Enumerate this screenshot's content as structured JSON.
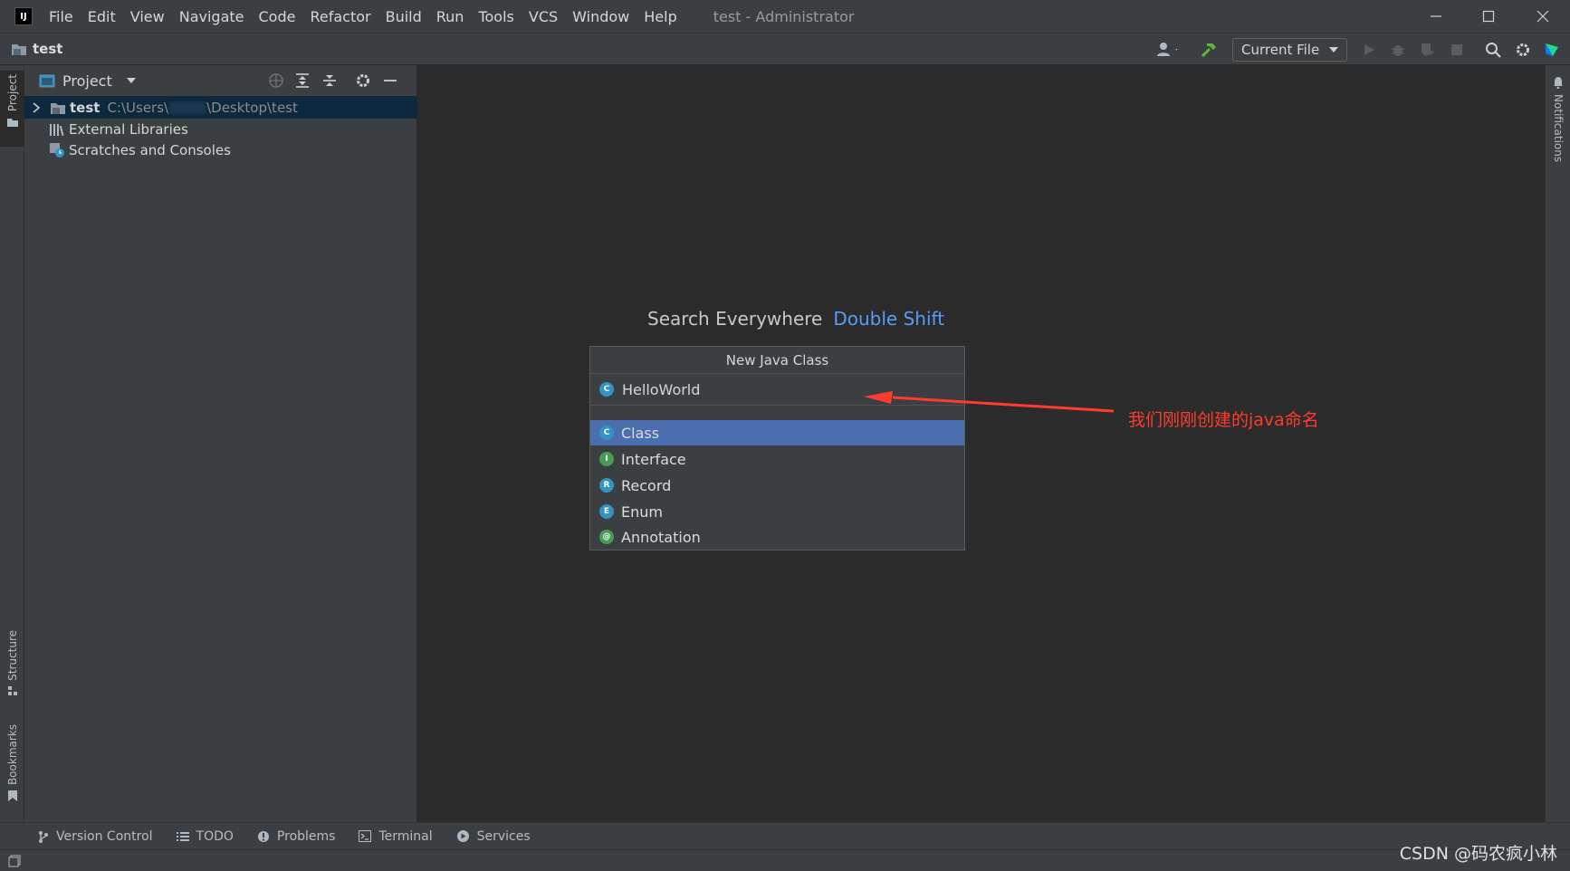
{
  "menubar": {
    "logo_text": "IJ",
    "items": [
      "File",
      "Edit",
      "View",
      "Navigate",
      "Code",
      "Refactor",
      "Build",
      "Run",
      "Tools",
      "VCS",
      "Window",
      "Help"
    ],
    "title": "test - Administrator"
  },
  "navbar": {
    "breadcrumb": "test",
    "run_config": "Current File"
  },
  "left_strip": {
    "project": "Project",
    "structure": "Structure",
    "bookmarks": "Bookmarks"
  },
  "project_panel": {
    "title": "Project",
    "tree": [
      {
        "label": "test",
        "path_prefix": "C:\\Users\\",
        "path_suffix": "\\Desktop\\test"
      },
      {
        "label": "External Libraries"
      },
      {
        "label": "Scratches and Consoles"
      }
    ]
  },
  "editor": {
    "hint_text": "Search Everywhere",
    "hint_shortcut": "Double Shift"
  },
  "popup": {
    "title": "New Java Class",
    "input_value": "HelloWorld",
    "kinds": [
      {
        "label": "Class",
        "letter": "C",
        "color": "#3592c4"
      },
      {
        "label": "Interface",
        "letter": "I",
        "color": "#499c54"
      },
      {
        "label": "Record",
        "letter": "R",
        "color": "#3592c4"
      },
      {
        "label": "Enum",
        "letter": "E",
        "color": "#3592c4"
      },
      {
        "label": "Annotation",
        "letter": "@",
        "color": "#499c54"
      }
    ],
    "selected": "Class"
  },
  "annotation": {
    "text": "我们刚刚创建的java命名",
    "color": "#ff3b30"
  },
  "right_strip": {
    "notifications": "Notifications"
  },
  "bottom_bar": {
    "tabs": [
      "Version Control",
      "TODO",
      "Problems",
      "Terminal",
      "Services"
    ]
  },
  "watermark": "CSDN @码农疯小林"
}
